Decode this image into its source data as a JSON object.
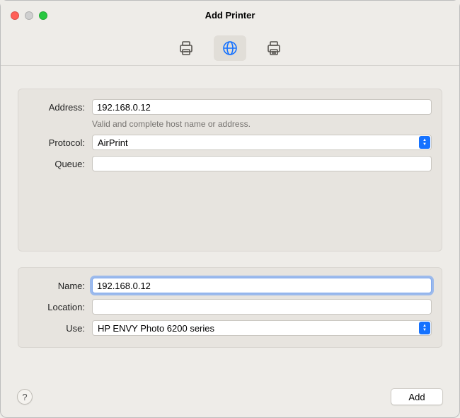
{
  "window": {
    "title": "Add Printer"
  },
  "toolbar": {
    "tabs": [
      {
        "name": "default",
        "selected": false
      },
      {
        "name": "ip",
        "selected": true
      },
      {
        "name": "windows",
        "selected": false
      }
    ]
  },
  "connection": {
    "address_label": "Address:",
    "address_value": "192.168.0.12",
    "address_hint": "Valid and complete host name or address.",
    "protocol_label": "Protocol:",
    "protocol_value": "AirPrint",
    "queue_label": "Queue:",
    "queue_value": ""
  },
  "details": {
    "name_label": "Name:",
    "name_value": "192.168.0.12",
    "location_label": "Location:",
    "location_value": "",
    "use_label": "Use:",
    "use_value": "HP ENVY Photo 6200 series"
  },
  "footer": {
    "help_label": "?",
    "add_label": "Add"
  }
}
